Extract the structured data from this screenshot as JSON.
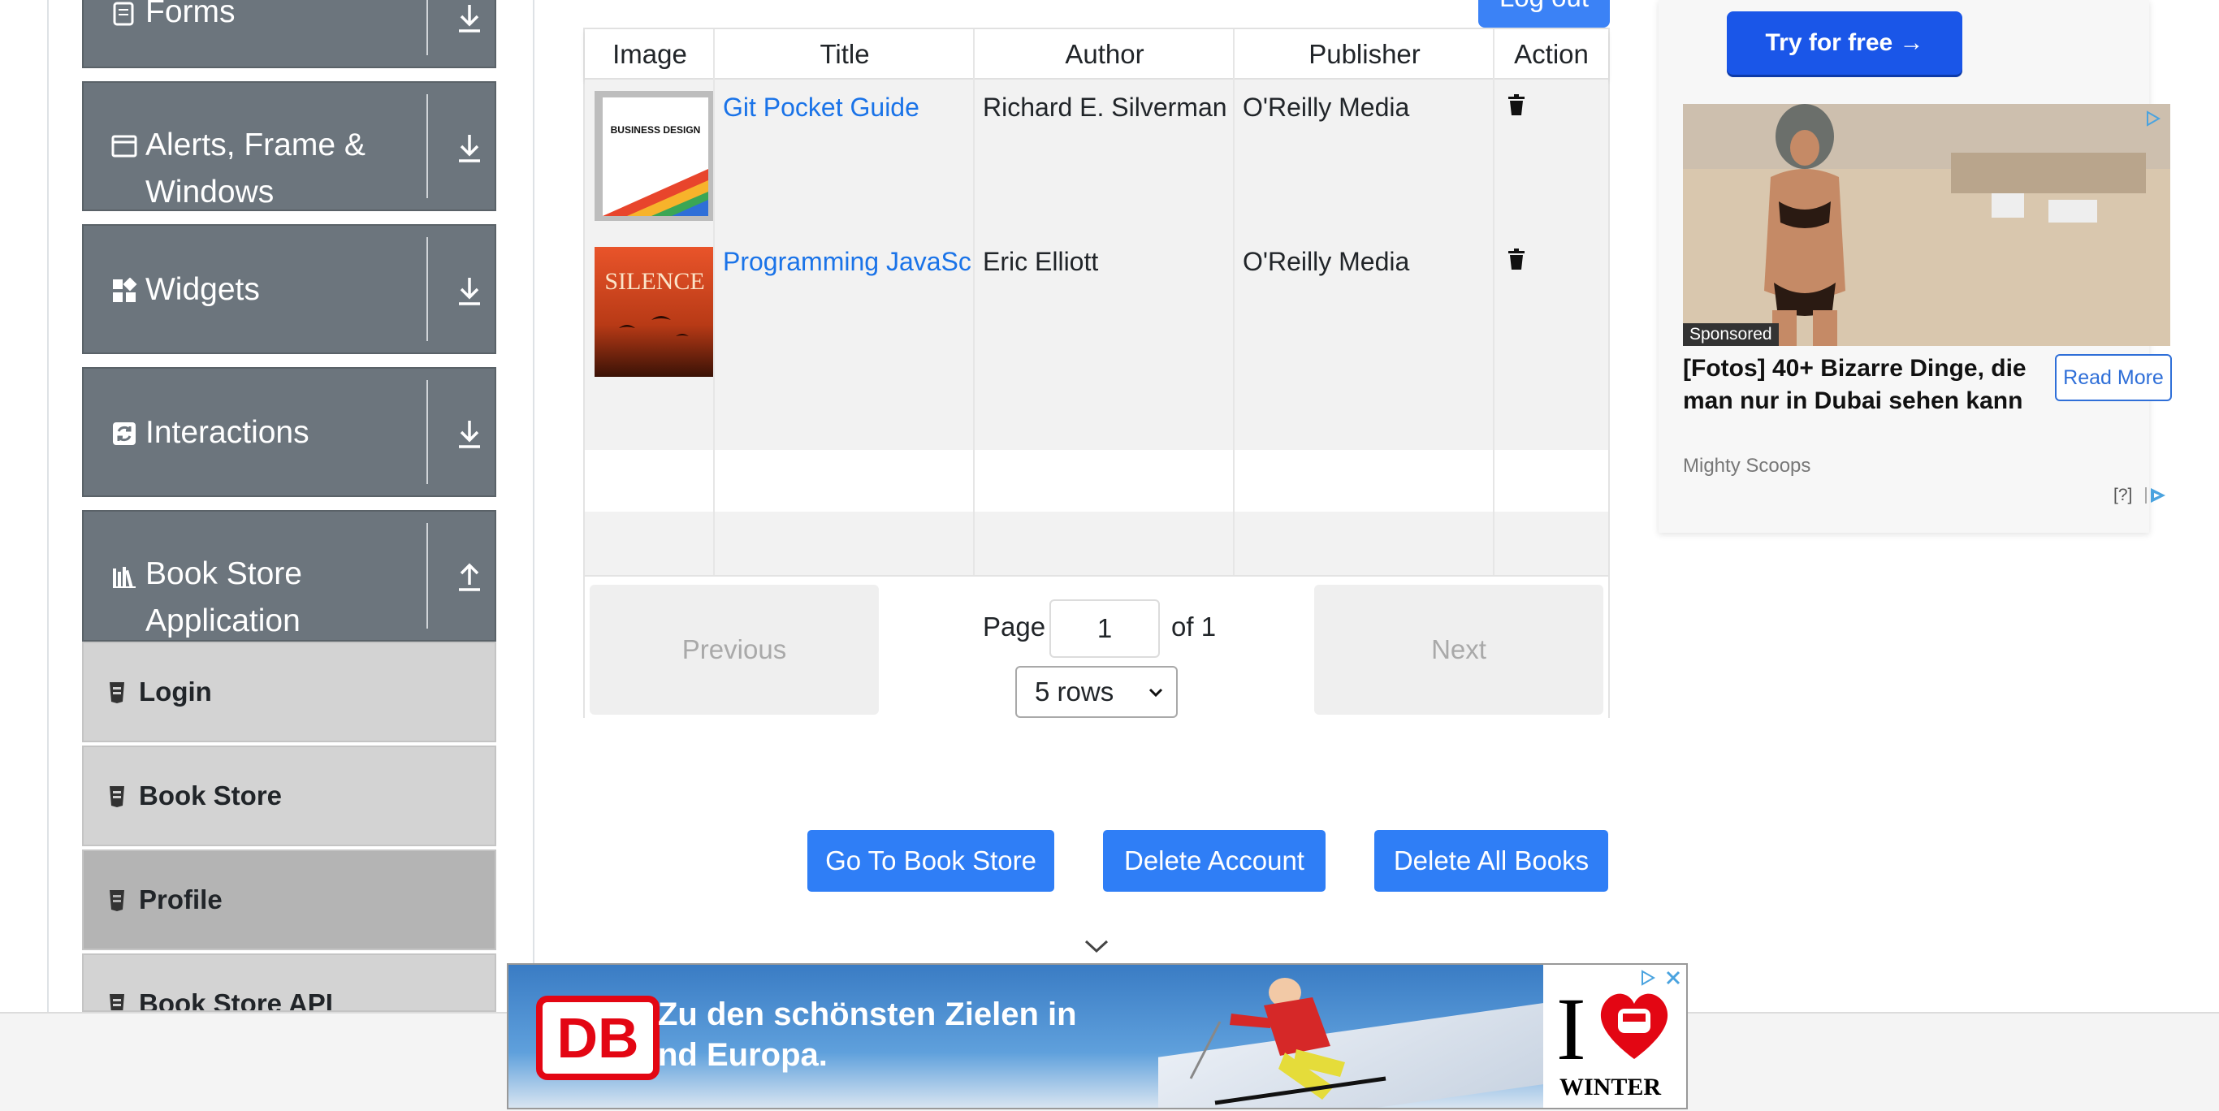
{
  "sidebar": {
    "groups": [
      {
        "label": "Forms"
      },
      {
        "label": "Alerts, Frame & Windows"
      },
      {
        "label": "Widgets"
      },
      {
        "label": "Interactions"
      },
      {
        "label": "Book Store Application"
      }
    ],
    "book_store_items": [
      {
        "label": "Login"
      },
      {
        "label": "Book Store"
      },
      {
        "label": "Profile"
      },
      {
        "label": "Book Store API"
      }
    ]
  },
  "header": {
    "logout_label": "Log out"
  },
  "table": {
    "columns": [
      "Image",
      "Title",
      "Author",
      "Publisher",
      "Action"
    ],
    "rows": [
      {
        "title": "Git Pocket Guide",
        "author": "Richard E. Silverman",
        "publisher": "O'Reilly Media",
        "cover_text": "BUSINESS DESIGN"
      },
      {
        "title": "Programming JavaSc",
        "author": "Eric Elliott",
        "publisher": "O'Reilly Media",
        "cover_text": "SILENCE"
      }
    ]
  },
  "pagination": {
    "previous_label": "Previous",
    "next_label": "Next",
    "page_label": "Page",
    "page_value": "1",
    "of_label": "of 1",
    "rows_selected": "5 rows"
  },
  "actions": {
    "go_to_store": "Go To Book Store",
    "delete_account": "Delete Account",
    "delete_all_books": "Delete All Books"
  },
  "ad_right": {
    "try_button": "Try for free →",
    "sponsored": "Sponsored",
    "title": "[Fotos] 40+ Bizarre Dinge, die man nur in Dubai sehen kann",
    "read_more": "Read More",
    "source": "Mighty Scoops",
    "help": "[?]"
  },
  "ad_banner": {
    "logo": "DB",
    "line1": "Zu den schönsten Zielen in",
    "line2": "nd Europa.",
    "brand_word": "WINTER"
  },
  "colors": {
    "sidebar_group": "#6c757d",
    "sidebar_item": "#d3d3d3",
    "primary": "#2f7ef6",
    "link": "#1a73e8"
  }
}
